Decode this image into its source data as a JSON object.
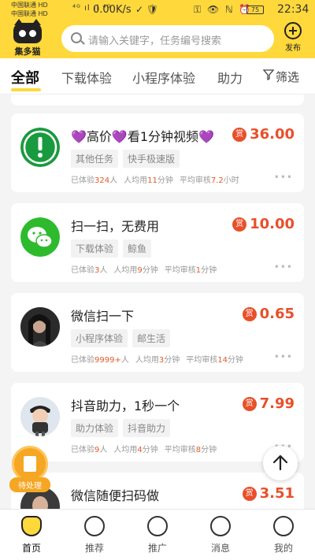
{
  "status_bar": {
    "carrier1": "中国联通 HD",
    "carrier2": "中国联通 HD",
    "signal_text": "⁴ᴳ ıl ıl ⁴ᴳ",
    "speed": "0.00K/s",
    "mid_icons": "✓ 🛡",
    "right_icons": "⚿ 👁 ℕ ⏰",
    "battery": "75",
    "time": "22:34"
  },
  "header": {
    "logo_text": "集多猫",
    "search_placeholder": "请输入关键字，任务编号搜索",
    "publish_label": "发布"
  },
  "tabs": {
    "items": [
      "全部",
      "下载体验",
      "小程序体验",
      "助力"
    ],
    "filter_label": "筛选"
  },
  "tasks": [
    {
      "title": "💜高价💜看1分钟视频💜",
      "tags": [
        "其他任务",
        "快手极速版"
      ],
      "reward": "36.00",
      "reward_badge": "赏",
      "stats": {
        "done_label": "已体验",
        "done": "324",
        "done_unit": "人",
        "avg_label": "人均用",
        "avg": "11",
        "avg_unit": "分钟",
        "review_label": "平均审核",
        "review": "7.2",
        "review_unit": "小时"
      },
      "more": "•••",
      "avatar": "alert-icon"
    },
    {
      "title": "扫一扫，无费用",
      "tags": [
        "下载体验",
        "鲸鱼"
      ],
      "reward": "10.00",
      "reward_badge": "赏",
      "stats": {
        "done_label": "已体验",
        "done": "3",
        "done_unit": "人",
        "avg_label": "人均用",
        "avg": "9",
        "avg_unit": "分钟",
        "review_label": "平均审核",
        "review": "1",
        "review_unit": "分钟"
      },
      "more": "•••",
      "avatar": "wechat-icon"
    },
    {
      "title": "微信扫一下",
      "tags": [
        "小程序体验",
        "邮生活"
      ],
      "reward": "0.65",
      "reward_badge": "赏",
      "stats": {
        "done_label": "已体验",
        "done": "9999+",
        "done_unit": "人",
        "avg_label": "人均用",
        "avg": "3",
        "avg_unit": "分钟",
        "review_label": "平均审核",
        "review": "14",
        "review_unit": "分钟"
      },
      "more": "•••",
      "avatar": "user-photo"
    },
    {
      "title": "抖音助力，1秒一个",
      "tags": [
        "助力体验",
        "抖音助力"
      ],
      "reward": "7.99",
      "reward_badge": "赏",
      "stats": {
        "done_label": "已体验",
        "done": "9",
        "done_unit": "人",
        "avg_label": "人均用",
        "avg": "4",
        "avg_unit": "分钟",
        "review_label": "平均审核",
        "review": "8",
        "review_unit": "分钟"
      },
      "more": "•••",
      "avatar": "cartoon-avatar"
    },
    {
      "title": "微信随便扫码做",
      "reward": "3.51",
      "reward_badge": "赏"
    }
  ],
  "floating": {
    "pending_label": "待处理"
  },
  "bottom_nav": {
    "items": [
      "首页",
      "推荐",
      "推广",
      "消息",
      "我的"
    ]
  },
  "colors": {
    "brand_yellow": "#ffd83b",
    "reward_red": "#e8502a"
  }
}
